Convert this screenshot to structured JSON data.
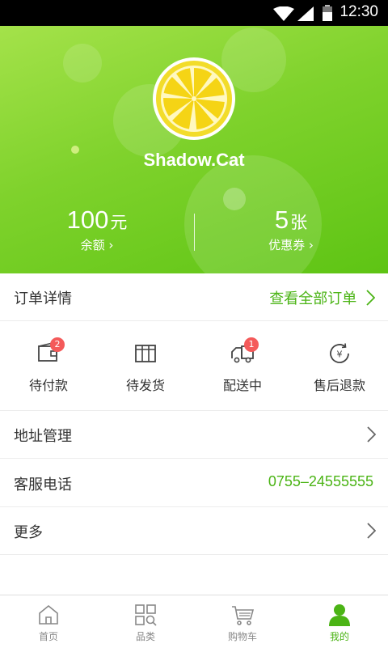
{
  "status_bar": {
    "time": "12:30"
  },
  "profile": {
    "username": "Shadow.Cat",
    "balance_value": "100",
    "balance_unit": "元",
    "balance_label": "余额 ›",
    "coupon_value": "5",
    "coupon_unit": "张",
    "coupon_label": "优惠券 ›"
  },
  "orders_section": {
    "title": "订单详情",
    "view_all": "查看全部订单",
    "items": [
      {
        "label": "待付款",
        "badge": "2",
        "icon": "wallet-icon"
      },
      {
        "label": "待发货",
        "badge": "",
        "icon": "box-icon"
      },
      {
        "label": "配送中",
        "badge": "1",
        "icon": "truck-icon"
      },
      {
        "label": "售后退款",
        "badge": "",
        "icon": "refund-icon"
      }
    ]
  },
  "menu": {
    "address": "地址管理",
    "service_label": "客服电话",
    "service_phone": "0755–24555555",
    "more": "更多"
  },
  "bottom_nav": [
    {
      "label": "首页",
      "icon": "home-icon"
    },
    {
      "label": "品类",
      "icon": "category-icon"
    },
    {
      "label": "购物车",
      "icon": "cart-icon"
    },
    {
      "label": "我的",
      "icon": "user-icon",
      "active": true
    }
  ],
  "colors": {
    "accent": "#4bb415",
    "badge": "#f45a5a",
    "header_start": "#a4e24a",
    "header_end": "#5ec414"
  }
}
